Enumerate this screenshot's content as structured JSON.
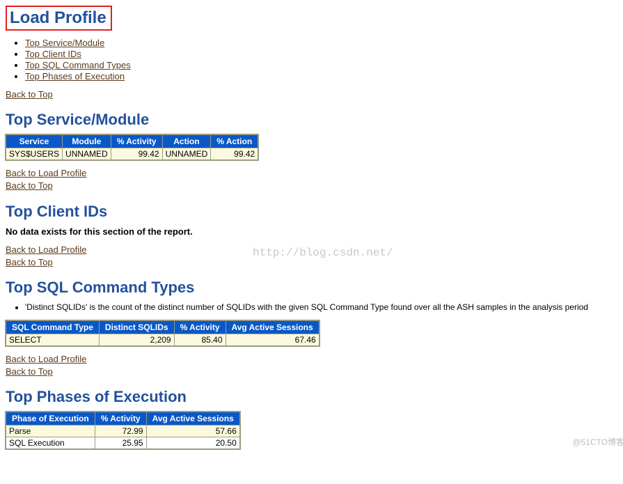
{
  "main_title": "Load Profile",
  "toc": [
    "Top Service/Module",
    "Top Client IDs",
    "Top SQL Command Types",
    "Top Phases of Execution"
  ],
  "back_links": {
    "load_profile": "Back to Load Profile",
    "top": "Back to Top"
  },
  "sections": {
    "service_module": {
      "title": "Top Service/Module",
      "headers": [
        "Service",
        "Module",
        "% Activity",
        "Action",
        "% Action"
      ],
      "rows": [
        [
          "SYS$USERS",
          "UNNAMED",
          "99.42",
          "UNNAMED",
          "99.42"
        ]
      ],
      "align": [
        "txt",
        "txt",
        "num",
        "txt",
        "num"
      ]
    },
    "client_ids": {
      "title": "Top Client IDs",
      "no_data": "No data exists for this section of the report."
    },
    "sql_command_types": {
      "title": "Top SQL Command Types",
      "note": "'Distinct SQLIDs' is the count of the distinct number of SQLIDs with the given SQL Command Type found over all the ASH samples in the analysis period",
      "headers": [
        "SQL Command Type",
        "Distinct SQLIDs",
        "% Activity",
        "Avg Active Sessions"
      ],
      "rows": [
        [
          "SELECT",
          "2,209",
          "85.40",
          "67.46"
        ]
      ],
      "align": [
        "txt",
        "num",
        "num",
        "num"
      ]
    },
    "phases": {
      "title": "Top Phases of Execution",
      "headers": [
        "Phase of Execution",
        "% Activity",
        "Avg Active Sessions"
      ],
      "rows": [
        [
          "Parse",
          "72.99",
          "57.66"
        ],
        [
          "SQL Execution",
          "25.95",
          "20.50"
        ]
      ],
      "align": [
        "txt",
        "num",
        "num"
      ]
    }
  },
  "watermarks": {
    "center": "http://blog.csdn.net/",
    "corner": "@51CTO博客"
  }
}
